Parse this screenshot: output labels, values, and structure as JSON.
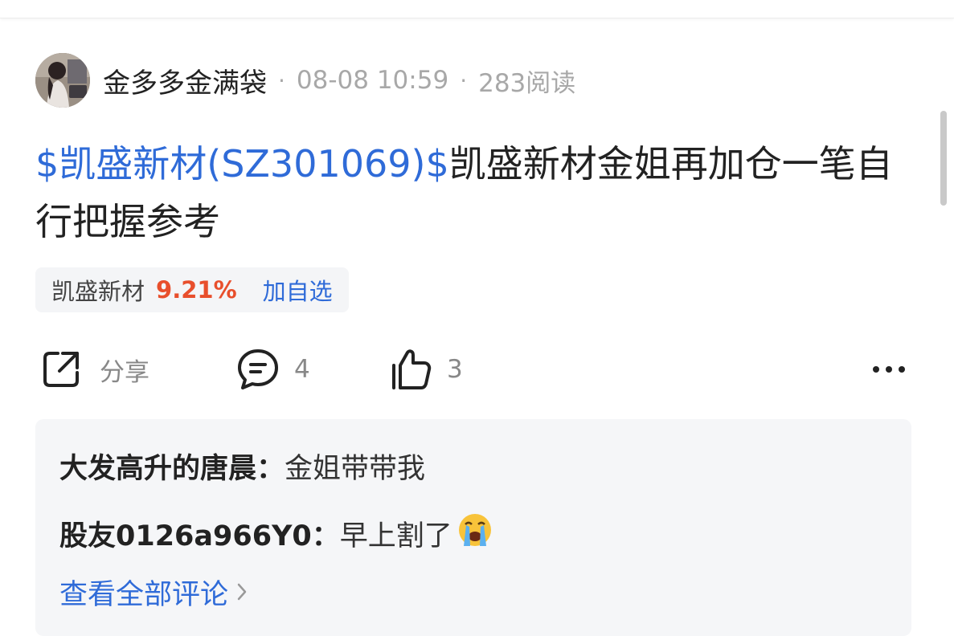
{
  "post": {
    "author": "金多多金满袋",
    "separator": "·",
    "date": "08-08 10:59",
    "reads": "283阅读",
    "stock_link": "$凯盛新材(SZ301069)$",
    "body_text": "凯盛新材金姐再加仓一笔自行把握参考"
  },
  "stock_chip": {
    "name": "凯盛新材",
    "change": "9.21%",
    "add_label": "加自选"
  },
  "actions": {
    "share_label": "分享",
    "comment_count": "4",
    "like_count": "3"
  },
  "comments": [
    {
      "name": "大发高升的唐晨：",
      "text": "金姐带带我"
    },
    {
      "name": "股友0126a966Y0：",
      "text": "早上割了",
      "emoji": "crying-face-icon"
    }
  ],
  "view_all_label": "查看全部评论",
  "colors": {
    "link": "#2f6bd8",
    "gain": "#e84f2c",
    "muted": "#a8a8a8"
  }
}
